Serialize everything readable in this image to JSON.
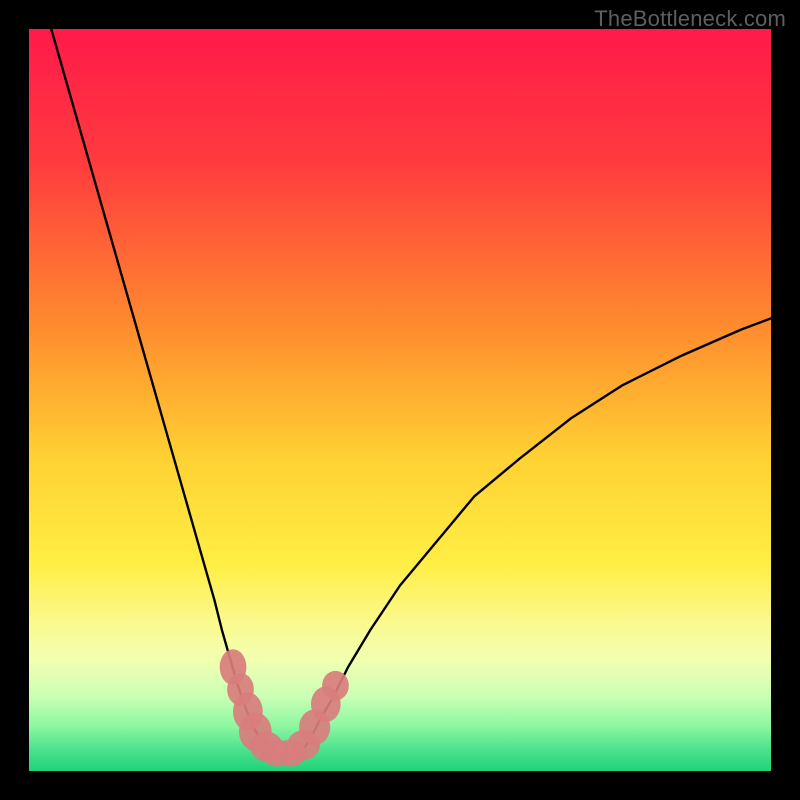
{
  "watermark": "TheBottleneck.com",
  "colors": {
    "bg": "#000000",
    "curve": "#000000",
    "marker_fill": "#d97d7d",
    "marker_stroke": "#d97d7d"
  },
  "chart_data": {
    "type": "line",
    "title": "",
    "xlabel": "",
    "ylabel": "",
    "xlim": [
      0,
      100
    ],
    "ylim": [
      0,
      100
    ],
    "gradient_stops": [
      {
        "offset": 0,
        "color": "#ff1a4a"
      },
      {
        "offset": 18,
        "color": "#ff3b3e"
      },
      {
        "offset": 40,
        "color": "#ff8b2e"
      },
      {
        "offset": 58,
        "color": "#ffd233"
      },
      {
        "offset": 72,
        "color": "#ffee44"
      },
      {
        "offset": 80,
        "color": "#fbf98f"
      },
      {
        "offset": 85,
        "color": "#f2ffb0"
      },
      {
        "offset": 90,
        "color": "#c9ffb5"
      },
      {
        "offset": 94,
        "color": "#8bf7a0"
      },
      {
        "offset": 97,
        "color": "#4ee28e"
      },
      {
        "offset": 100,
        "color": "#1fd37a"
      }
    ],
    "series": [
      {
        "name": "bottleneck-curve",
        "x": [
          3,
          5,
          7,
          9,
          11,
          13,
          15,
          17,
          19,
          21,
          23,
          25,
          26,
          27,
          28,
          29,
          30,
          31,
          32,
          33,
          34,
          35,
          36,
          37,
          38,
          39,
          41,
          43,
          46,
          50,
          55,
          60,
          66,
          73,
          80,
          88,
          96,
          100
        ],
        "y": [
          100,
          93,
          86,
          79,
          72,
          65,
          58,
          51,
          44,
          37,
          30,
          23,
          19,
          15.5,
          12,
          9,
          6.5,
          4.5,
          3,
          2.2,
          2,
          2,
          2.2,
          3,
          4.5,
          6.5,
          10,
          14,
          19,
          25,
          31,
          37,
          42,
          47.5,
          52,
          56,
          59.5,
          61
        ]
      }
    ],
    "markers": [
      {
        "x": 27.5,
        "y": 14,
        "rx": 1.8,
        "ry": 2.4
      },
      {
        "x": 28.5,
        "y": 11,
        "rx": 1.8,
        "ry": 2.2
      },
      {
        "x": 29.5,
        "y": 8,
        "rx": 2.0,
        "ry": 2.6
      },
      {
        "x": 30.5,
        "y": 5.3,
        "rx": 2.2,
        "ry": 2.6
      },
      {
        "x": 32.0,
        "y": 3.3,
        "rx": 2.2,
        "ry": 2.0
      },
      {
        "x": 33.5,
        "y": 2.4,
        "rx": 2.2,
        "ry": 1.8
      },
      {
        "x": 35.2,
        "y": 2.4,
        "rx": 2.2,
        "ry": 1.8
      },
      {
        "x": 37.0,
        "y": 3.5,
        "rx": 2.2,
        "ry": 2.0
      },
      {
        "x": 38.5,
        "y": 5.9,
        "rx": 2.1,
        "ry": 2.4
      },
      {
        "x": 40.0,
        "y": 9.0,
        "rx": 2.0,
        "ry": 2.4
      },
      {
        "x": 41.3,
        "y": 11.5,
        "rx": 1.8,
        "ry": 2.0
      }
    ]
  }
}
